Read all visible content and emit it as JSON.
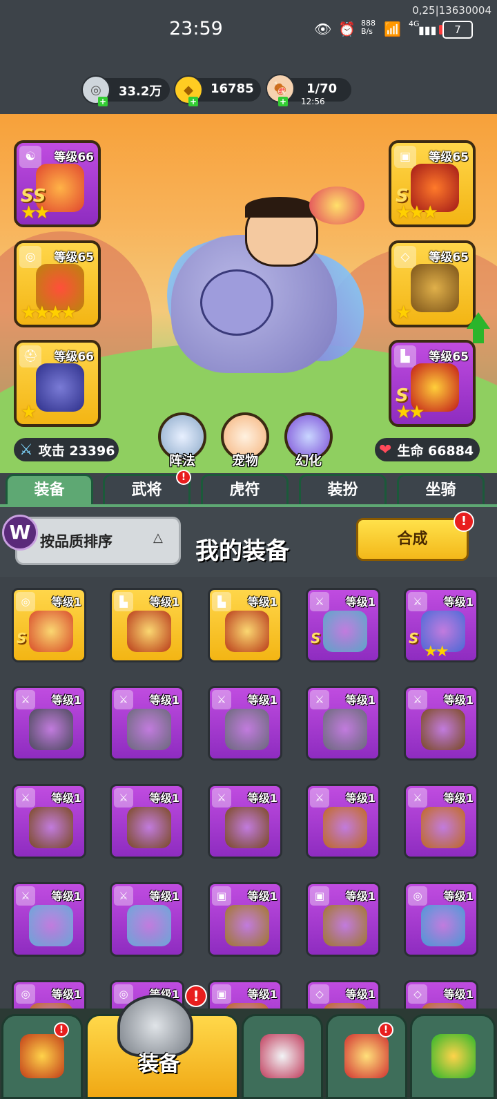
{
  "status_bar": {
    "debug": "0,25|13630004",
    "time": "23:59",
    "net_speed": "888\nB/s",
    "network": "4G",
    "battery": "7"
  },
  "resources": {
    "silver": "33.2万",
    "gold": "16785",
    "stamina": "1/70",
    "stamina_timer": "12:56"
  },
  "equipped_slots": [
    {
      "level": "等级66",
      "quality": "purple",
      "grade": "SS",
      "stars": "★★"
    },
    {
      "level": "等级65",
      "quality": "gold",
      "grade": "",
      "stars": "★★★★"
    },
    {
      "level": "等级66",
      "quality": "gold",
      "grade": "",
      "stars": "★"
    },
    {
      "level": "等级65",
      "quality": "gold",
      "grade": "S",
      "stars": "★★★"
    },
    {
      "level": "等级65",
      "quality": "gold",
      "grade": "",
      "stars": "★"
    },
    {
      "level": "等级65",
      "quality": "purple",
      "grade": "S",
      "stars": "★★"
    }
  ],
  "stats": {
    "attack": "攻击 23396",
    "hp": "生命 66884"
  },
  "hero_buttons": {
    "formation": "阵法",
    "pet": "宠物",
    "transform": "幻化"
  },
  "tabs": [
    "装备",
    "武将",
    "虎符",
    "装扮",
    "坐骑"
  ],
  "equip_header": {
    "sort": "按品质排序",
    "title": "我的装备",
    "synthesize": "合成",
    "logo_letter": "W"
  },
  "inventory": [
    {
      "level": "等级1",
      "quality": "gold",
      "grade": "S",
      "stars": ""
    },
    {
      "level": "等级1",
      "quality": "gold",
      "grade": "",
      "stars": ""
    },
    {
      "level": "等级1",
      "quality": "gold",
      "grade": "",
      "stars": ""
    },
    {
      "level": "等级1",
      "quality": "purple",
      "grade": "S",
      "stars": ""
    },
    {
      "level": "等级1",
      "quality": "purple",
      "grade": "S",
      "stars": "★★"
    },
    {
      "level": "等级1",
      "quality": "purple",
      "grade": "",
      "stars": ""
    },
    {
      "level": "等级1",
      "quality": "purple",
      "grade": "",
      "stars": ""
    },
    {
      "level": "等级1",
      "quality": "purple",
      "grade": "",
      "stars": ""
    },
    {
      "level": "等级1",
      "quality": "purple",
      "grade": "",
      "stars": ""
    },
    {
      "level": "等级1",
      "quality": "purple",
      "grade": "",
      "stars": ""
    },
    {
      "level": "等级1",
      "quality": "purple",
      "grade": "",
      "stars": ""
    },
    {
      "level": "等级1",
      "quality": "purple",
      "grade": "",
      "stars": ""
    },
    {
      "level": "等级1",
      "quality": "purple",
      "grade": "",
      "stars": ""
    },
    {
      "level": "等级1",
      "quality": "purple",
      "grade": "",
      "stars": ""
    },
    {
      "level": "等级1",
      "quality": "purple",
      "grade": "",
      "stars": ""
    },
    {
      "level": "等级1",
      "quality": "purple",
      "grade": "",
      "stars": ""
    },
    {
      "level": "等级1",
      "quality": "purple",
      "grade": "",
      "stars": ""
    },
    {
      "level": "等级1",
      "quality": "purple",
      "grade": "",
      "stars": ""
    },
    {
      "level": "等级1",
      "quality": "purple",
      "grade": "",
      "stars": ""
    },
    {
      "level": "等级1",
      "quality": "purple",
      "grade": "",
      "stars": ""
    },
    {
      "level": "等级1",
      "quality": "purple",
      "grade": "",
      "stars": ""
    },
    {
      "level": "等级1",
      "quality": "purple",
      "grade": "",
      "stars": ""
    },
    {
      "level": "等级1",
      "quality": "purple",
      "grade": "",
      "stars": ""
    },
    {
      "level": "等级1",
      "quality": "purple",
      "grade": "",
      "stars": ""
    },
    {
      "level": "等级1",
      "quality": "purple",
      "grade": "",
      "stars": ""
    }
  ],
  "bottom_nav": {
    "equip_label": "装备",
    "badge": "!"
  },
  "colors": {
    "gold": "#f3b514",
    "purple": "#a63bd6",
    "accent_green": "#5ea873",
    "badge_red": "#e81e1e"
  }
}
